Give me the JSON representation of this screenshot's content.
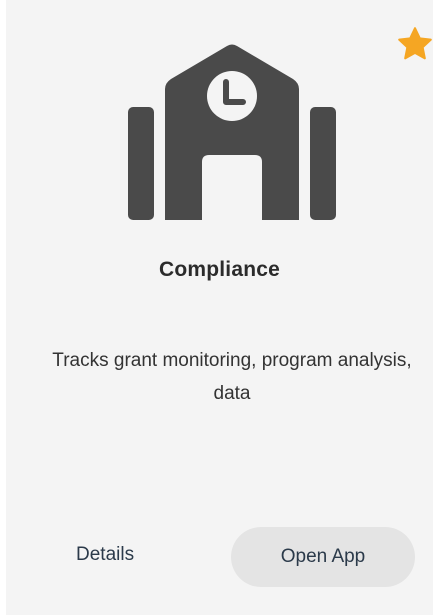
{
  "card": {
    "title": "Compliance",
    "description": "Tracks grant monitoring, program analysis, data",
    "icon": "school-clock-icon",
    "favorite_icon": "star-icon",
    "favorite_color": "#f5a623",
    "icon_color": "#4a4a4a"
  },
  "actions": {
    "details_label": "Details",
    "open_label": "Open App"
  }
}
